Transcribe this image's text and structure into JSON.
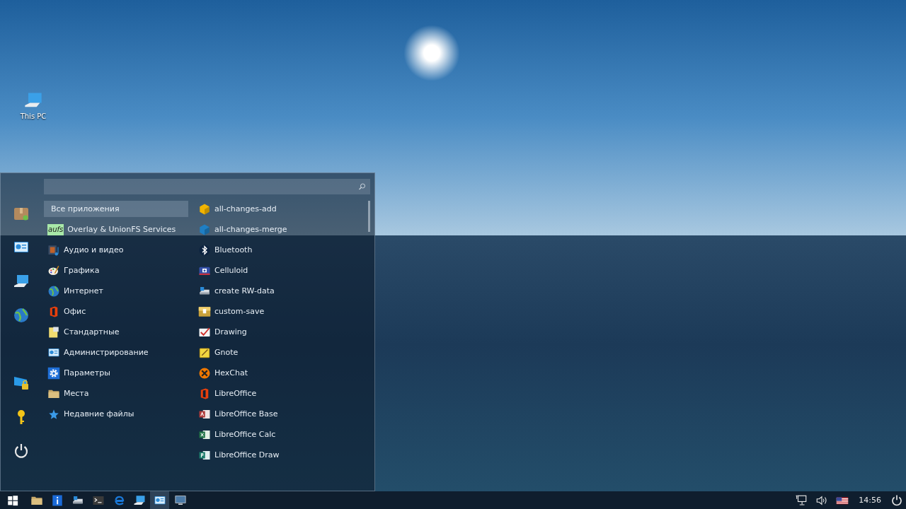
{
  "desktop_icons": [
    {
      "label": "This PC"
    }
  ],
  "menu": {
    "categories": [
      {
        "label": "Все приложения",
        "selected": true
      },
      {
        "label": "Overlay & UnionFS Services",
        "selected": false,
        "logo_text": "aufs"
      },
      {
        "label": "Аудио и видео",
        "selected": false
      },
      {
        "label": "Графика",
        "selected": false
      },
      {
        "label": "Интернет",
        "selected": false
      },
      {
        "label": "Офис",
        "selected": false
      },
      {
        "label": "Стандартные",
        "selected": false
      },
      {
        "label": "Администрирование",
        "selected": false
      },
      {
        "label": "Параметры",
        "selected": false
      },
      {
        "label": "Места",
        "selected": false
      },
      {
        "label": "Недавние файлы",
        "selected": false
      }
    ],
    "apps": [
      {
        "label": "all-changes-add"
      },
      {
        "label": "all-changes-merge"
      },
      {
        "label": "Bluetooth"
      },
      {
        "label": "Celluloid"
      },
      {
        "label": "create RW-data"
      },
      {
        "label": "custom-save"
      },
      {
        "label": "Drawing"
      },
      {
        "label": "Gnote"
      },
      {
        "label": "HexChat"
      },
      {
        "label": "LibreOffice"
      },
      {
        "label": "LibreOffice Base"
      },
      {
        "label": "LibreOffice Calc"
      },
      {
        "label": "LibreOffice Draw"
      }
    ]
  },
  "taskbar": {
    "items": [
      {
        "selected": false
      },
      {
        "selected": false
      },
      {
        "selected": false
      },
      {
        "selected": false
      },
      {
        "selected": false
      },
      {
        "selected": false
      },
      {
        "selected": true
      },
      {
        "selected": false
      }
    ],
    "clock": "14:56"
  }
}
